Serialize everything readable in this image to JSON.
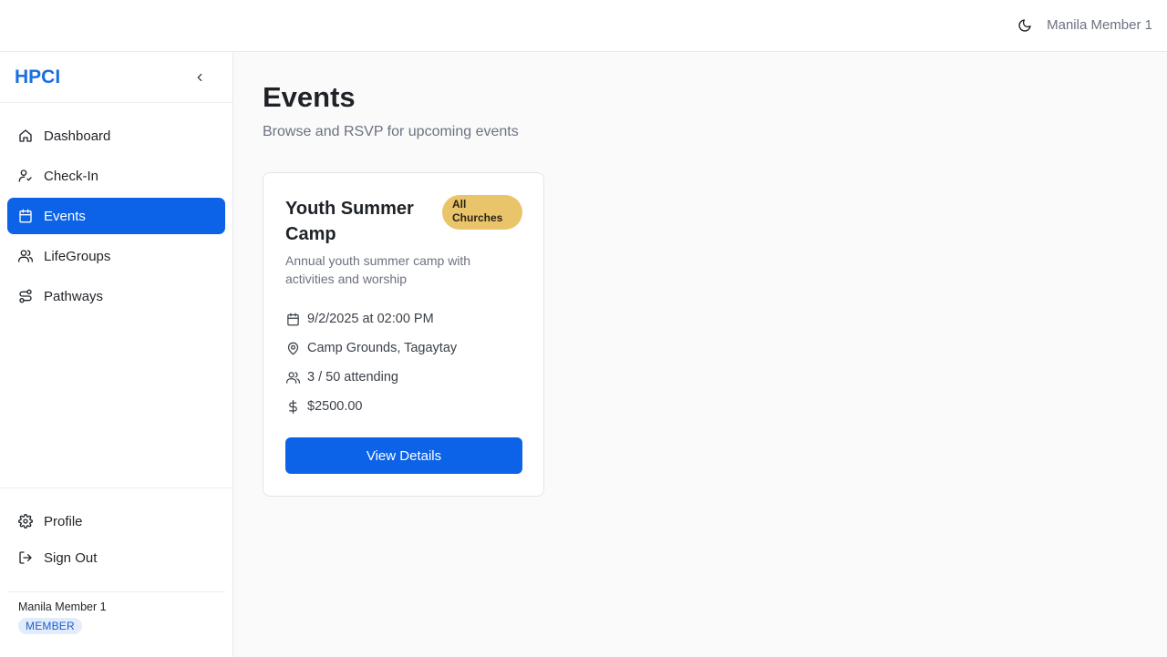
{
  "topbar": {
    "theme_icon": "moon-icon",
    "user_name": "Manila Member 1"
  },
  "sidebar": {
    "brand": "HPCI",
    "collapse_icon": "chevron-left-icon",
    "items": [
      {
        "label": "Dashboard",
        "icon": "home-icon",
        "active": false
      },
      {
        "label": "Check-In",
        "icon": "user-check-icon",
        "active": false
      },
      {
        "label": "Events",
        "icon": "calendar-icon",
        "active": true
      },
      {
        "label": "LifeGroups",
        "icon": "users-icon",
        "active": false
      },
      {
        "label": "Pathways",
        "icon": "route-icon",
        "active": false
      }
    ],
    "bottom_items": [
      {
        "label": "Profile",
        "icon": "gear-icon"
      },
      {
        "label": "Sign Out",
        "icon": "sign-out-icon"
      }
    ],
    "user": {
      "name": "Manila Member 1",
      "role": "MEMBER"
    }
  },
  "main": {
    "title": "Events",
    "subtitle": "Browse and RSVP for upcoming events",
    "events": [
      {
        "title": "Youth Summer Camp",
        "scope": "All Churches",
        "description": "Annual youth summer camp with activities and worship",
        "datetime": "9/2/2025 at 02:00 PM",
        "location": "Camp Grounds, Tagaytay",
        "attendance": "3 / 50 attending",
        "price": "$2500.00",
        "button_label": "View Details"
      }
    ]
  },
  "colors": {
    "accent": "#0c63e7",
    "brand": "#1a6fe0",
    "badge_gold": "#e9c46a",
    "role_badge_bg": "#e3ecfb"
  }
}
